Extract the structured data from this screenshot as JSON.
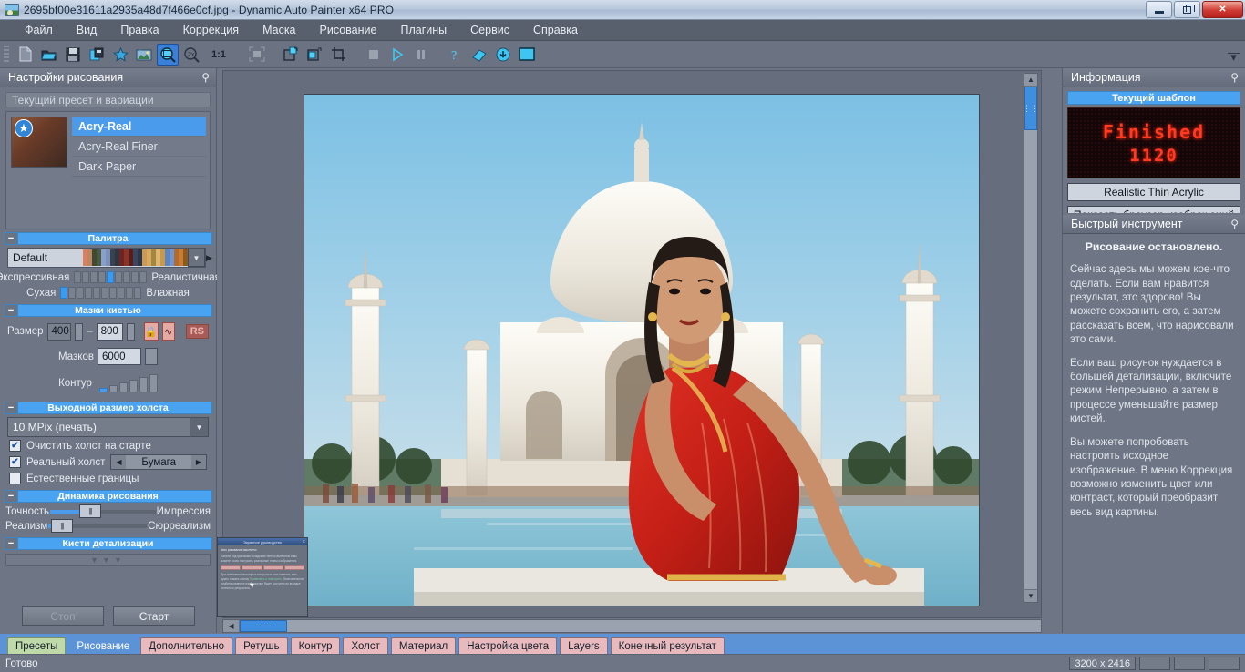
{
  "window": {
    "title": "2695bf00e31611a2935a48d7f466e0cf.jpg - Dynamic Auto Painter x64 PRO",
    "minimize_label": "Свернуть",
    "maximize_label": "Развернуть",
    "close_label": "✕"
  },
  "menubar": {
    "items": [
      {
        "label": "Файл"
      },
      {
        "label": "Вид"
      },
      {
        "label": "Правка"
      },
      {
        "label": "Коррекция"
      },
      {
        "label": "Маска"
      },
      {
        "label": "Рисование"
      },
      {
        "label": "Плагины"
      },
      {
        "label": "Сервис"
      },
      {
        "label": "Справка"
      }
    ]
  },
  "toolbar": {
    "zoom_ratio_label": "1:1",
    "items": [
      {
        "name": "new-document-icon",
        "title": "Создать"
      },
      {
        "name": "open-folder-icon",
        "title": "Открыть"
      },
      {
        "name": "save-icon",
        "title": "Сохранить"
      },
      {
        "name": "save-as-icon",
        "title": "Сохранить как"
      },
      {
        "name": "favorite-star-icon",
        "title": "Избранное"
      },
      {
        "name": "image-adjust-icon",
        "title": "Коррекция изображения"
      },
      {
        "name": "zoom-in-icon",
        "title": "Увеличить"
      },
      {
        "name": "zoom-out-icon",
        "title": "Уменьшить"
      },
      {
        "name": "fit-screen-icon",
        "title": "По размеру экрана"
      },
      {
        "name": "tile-left-icon",
        "title": "Плитка слева"
      },
      {
        "name": "tile-right-icon",
        "title": "Плитка справа"
      },
      {
        "name": "crop-icon",
        "title": "Обрезка"
      },
      {
        "name": "stop-square-icon",
        "title": "Стоп"
      },
      {
        "name": "play-icon",
        "title": "Старт"
      },
      {
        "name": "pause-icon",
        "title": "Пауза"
      },
      {
        "name": "help-question-icon",
        "title": "Справка"
      },
      {
        "name": "book-icon",
        "title": "Руководство"
      },
      {
        "name": "download-icon",
        "title": "Загрузить"
      },
      {
        "name": "window-icon",
        "title": "Окно"
      }
    ]
  },
  "left_panel": {
    "title": "Настройки рисования",
    "preset_group_label": "Текущий пресет и вариации",
    "presets": [
      {
        "label": "Acry-Real",
        "selected": true
      },
      {
        "label": "Acry-Real Finer",
        "selected": false
      },
      {
        "label": "Dark Paper",
        "selected": false
      }
    ],
    "palette": {
      "header": "Палитра",
      "selected": "Default",
      "swatch_colors": [
        "#d98060",
        "#c08460",
        "#3f4a35",
        "#4c5a42",
        "#8aa0cc",
        "#7c90bc",
        "#3a4250",
        "#2e3642",
        "#6e2420",
        "#8a3428",
        "#5a1c18",
        "#3a4660",
        "#2c3648",
        "#c89a58",
        "#d8a860",
        "#a08840",
        "#e0b470",
        "#c89a48",
        "#5a84c4",
        "#6e96d4",
        "#b46a28",
        "#c87c34",
        "#8a5a20"
      ],
      "left_label_1": "Экспрессивная",
      "right_label_1": "Реалистичная",
      "left_label_2": "Сухая",
      "right_label_2": "Влажная",
      "ticks_1_total": 9,
      "ticks_1_on": 4,
      "ticks_2_total": 10,
      "ticks_2_on": 0
    },
    "brush_strokes": {
      "header": "Мазки кистью",
      "size_label": "Размер",
      "size_min": "400",
      "size_max": "800",
      "lock_icon": "lock-icon",
      "curve_icon": "curve-icon",
      "rs_label": "RS",
      "strokes_label": "Мазков",
      "strokes_value": "6000",
      "contour_label": "Контур",
      "contour_bars": 6,
      "contour_selected_index": 0
    },
    "canvas_output": {
      "header": "Выходной размер холста",
      "selected": "10 MPix (печать)",
      "check_clear": "Очистить холст на старте",
      "check_clear_on": true,
      "check_real_canvas": "Реальный холст",
      "check_real_canvas_on": true,
      "canvas_material": "Бумага",
      "check_natural_borders": "Естественные границы",
      "check_natural_borders_on": false
    },
    "dynamics": {
      "header": "Динамика рисования",
      "row1_left": "Точность",
      "row1_right": "Импрессия",
      "row1_pct": 38,
      "row2_left": "Реализм",
      "row2_right": "Сюрреализм",
      "row2_pct": 8
    },
    "detail_brushes": {
      "header": "Кисти детализации"
    },
    "buttons": {
      "stop": "Стоп",
      "start": "Старт"
    }
  },
  "canvas": {
    "artwork_alt": "Картина: женщина в красном сари перед Тадж-Махалом",
    "guide_window": {
      "title": "Экранное руководство",
      "heading": "Авто рисование закончено",
      "text": "Панели под красными вкладками теперь включены и вы можете точно настроить различные этапы изображения.",
      "tabs": [
        "Контур",
        "Холст",
        "Материал",
        "Кисти"
      ],
      "text2_prefix": "При изменении некоторых настроек в этих панелях, вам нужно нажать кнопку ",
      "text2_link": "Применить и повторить.",
      "text3": "Окончательное комбинированное изображение будет доступно во вкладке конечного результата."
    }
  },
  "right_panel": {
    "info": {
      "title": "Информация",
      "template_header": "Текущий шаблон",
      "led_line1": "Finished",
      "led_line2": "1120",
      "template_name": "Realistic Thin Acrylic",
      "browser_button": "Показать браузер изображений"
    },
    "quick_tool": {
      "title": "Быстрый инструмент",
      "heading": "Рисование остановлено.",
      "paragraphs": [
        "Сейчас здесь мы можем кое-что сделать. Если вам нравится результат, это здорово! Вы можете сохранить его, а затем рассказать всем, что нарисовали это сами.",
        "Если ваш рисунок нуждается в большей детализации, включите режим Непрерывно, а затем в процессе уменьшайте размер кистей.",
        "Вы можете попробовать настроить исходное изображение. В меню Коррекция возможно изменить цвет или контраст, который преобразит весь вид картины."
      ]
    }
  },
  "tabs": [
    {
      "label": "Пресеты",
      "style": "green"
    },
    {
      "label": "Рисование",
      "style": "active"
    },
    {
      "label": "Дополнительно",
      "style": "pink"
    },
    {
      "label": "Ретушь",
      "style": "pink"
    },
    {
      "label": "Контур",
      "style": "pink"
    },
    {
      "label": "Холст",
      "style": "pink"
    },
    {
      "label": "Материал",
      "style": "pink"
    },
    {
      "label": "Настройка цвета",
      "style": "pink"
    },
    {
      "label": "Layers",
      "style": "pink"
    },
    {
      "label": "Конечный результат",
      "style": "pink"
    }
  ],
  "statusbar": {
    "text": "Готово",
    "dimensions": "3200 x 2416"
  },
  "colors": {
    "accent_blue": "#4aa3f0",
    "tab_active": "#5c93d6",
    "panel_bg": "#6e7686",
    "led_red": "#ff3b22"
  }
}
